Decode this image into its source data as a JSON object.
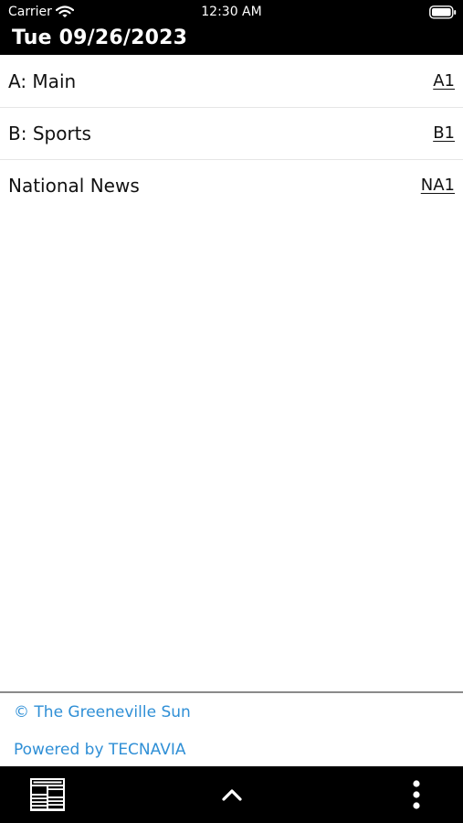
{
  "status_bar": {
    "carrier": "Carrier",
    "time": "12:30 AM",
    "wifi_icon": "wifi-icon",
    "battery_icon": "battery-icon"
  },
  "header": {
    "date": "Tue 09/26/2023"
  },
  "sections": [
    {
      "name": "A: Main",
      "page": "A1"
    },
    {
      "name": "B: Sports",
      "page": "B1"
    },
    {
      "name": "National News",
      "page": "NA1"
    }
  ],
  "footer": {
    "copyright": "© The Greeneville Sun",
    "powered_by": "Powered by TECNAVIA",
    "link_color": "#2f8fd6"
  },
  "bottom_bar": {
    "left_icon": "newspaper-icon",
    "center_icon": "chevron-up-icon",
    "right_icon": "more-vertical-icon"
  },
  "colors": {
    "bar_background": "#000000",
    "page_background": "#ffffff",
    "text": "#111111",
    "divider": "#e6e6e6"
  }
}
